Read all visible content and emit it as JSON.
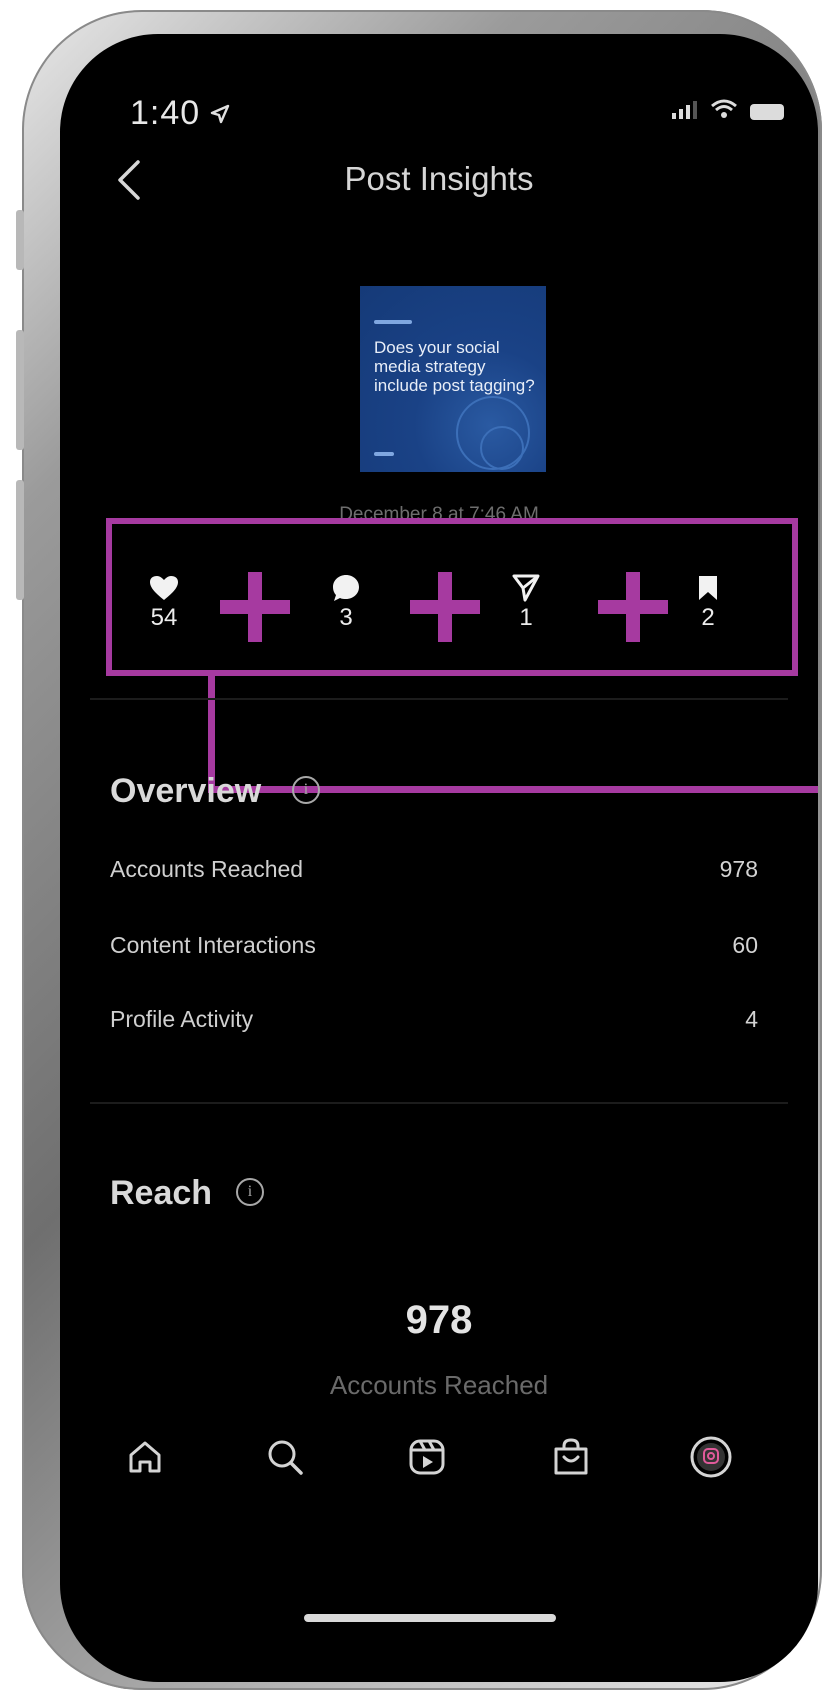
{
  "status_bar": {
    "time": "1:40"
  },
  "header": {
    "title": "Post Insights"
  },
  "post": {
    "thumbnail_text": "Does your social media strategy include post tagging?",
    "date": "December 8 at 7:46 AM"
  },
  "engagement": [
    {
      "icon": "heart-icon",
      "value": "54"
    },
    {
      "icon": "comment-icon",
      "value": "3"
    },
    {
      "icon": "share-icon",
      "value": "1"
    },
    {
      "icon": "bookmark-icon",
      "value": "2"
    }
  ],
  "overview": {
    "title": "Overview",
    "rows": [
      {
        "label": "Accounts Reached",
        "value": "978"
      },
      {
        "label": "Content Interactions",
        "value": "60"
      },
      {
        "label": "Profile Activity",
        "value": "4"
      }
    ]
  },
  "reach": {
    "title": "Reach",
    "value": "978",
    "label": "Accounts Reached"
  },
  "tab_bar": [
    "home-icon",
    "search-icon",
    "reels-icon",
    "shop-icon",
    "profile-icon"
  ],
  "annotation_color": "#a63aa0"
}
